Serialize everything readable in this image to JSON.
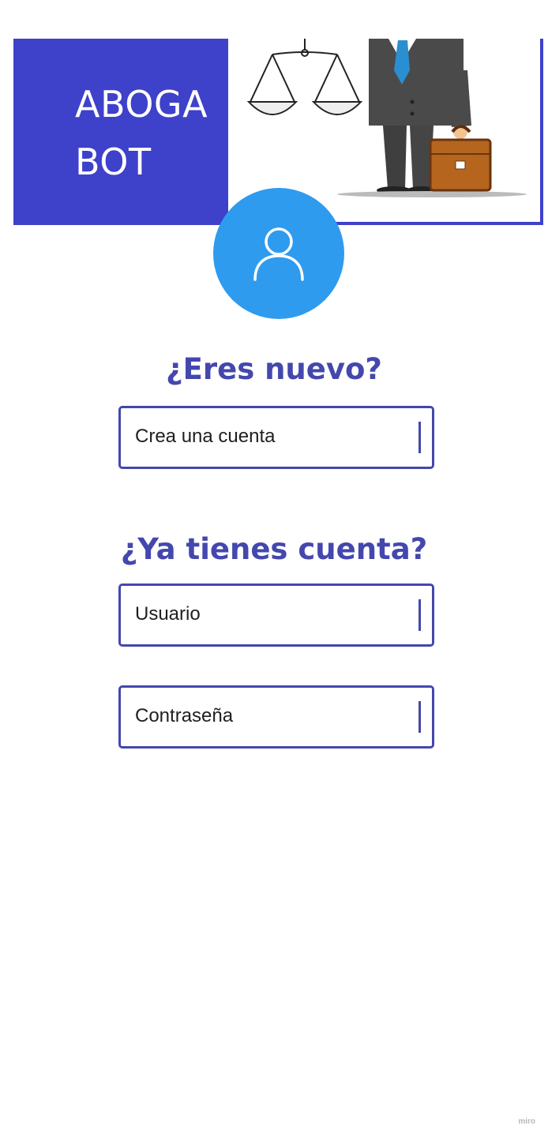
{
  "banner": {
    "brand_line_1": "ABOGA",
    "brand_line_2": "BOT",
    "background_color": "#3e41c9",
    "illustration": "lawyer-with-scales-and-briefcase"
  },
  "avatar": {
    "icon": "user-icon",
    "color": "#2e9bef"
  },
  "signup": {
    "heading": "¿Eres nuevo?",
    "create_account_label": "Crea una cuenta"
  },
  "login": {
    "heading": "¿Ya tienes cuenta?",
    "username_label": "Usuario",
    "password_label": "Contraseña"
  },
  "colors": {
    "accent": "#4447ad",
    "avatar": "#2e9bef"
  },
  "watermark": "miro"
}
